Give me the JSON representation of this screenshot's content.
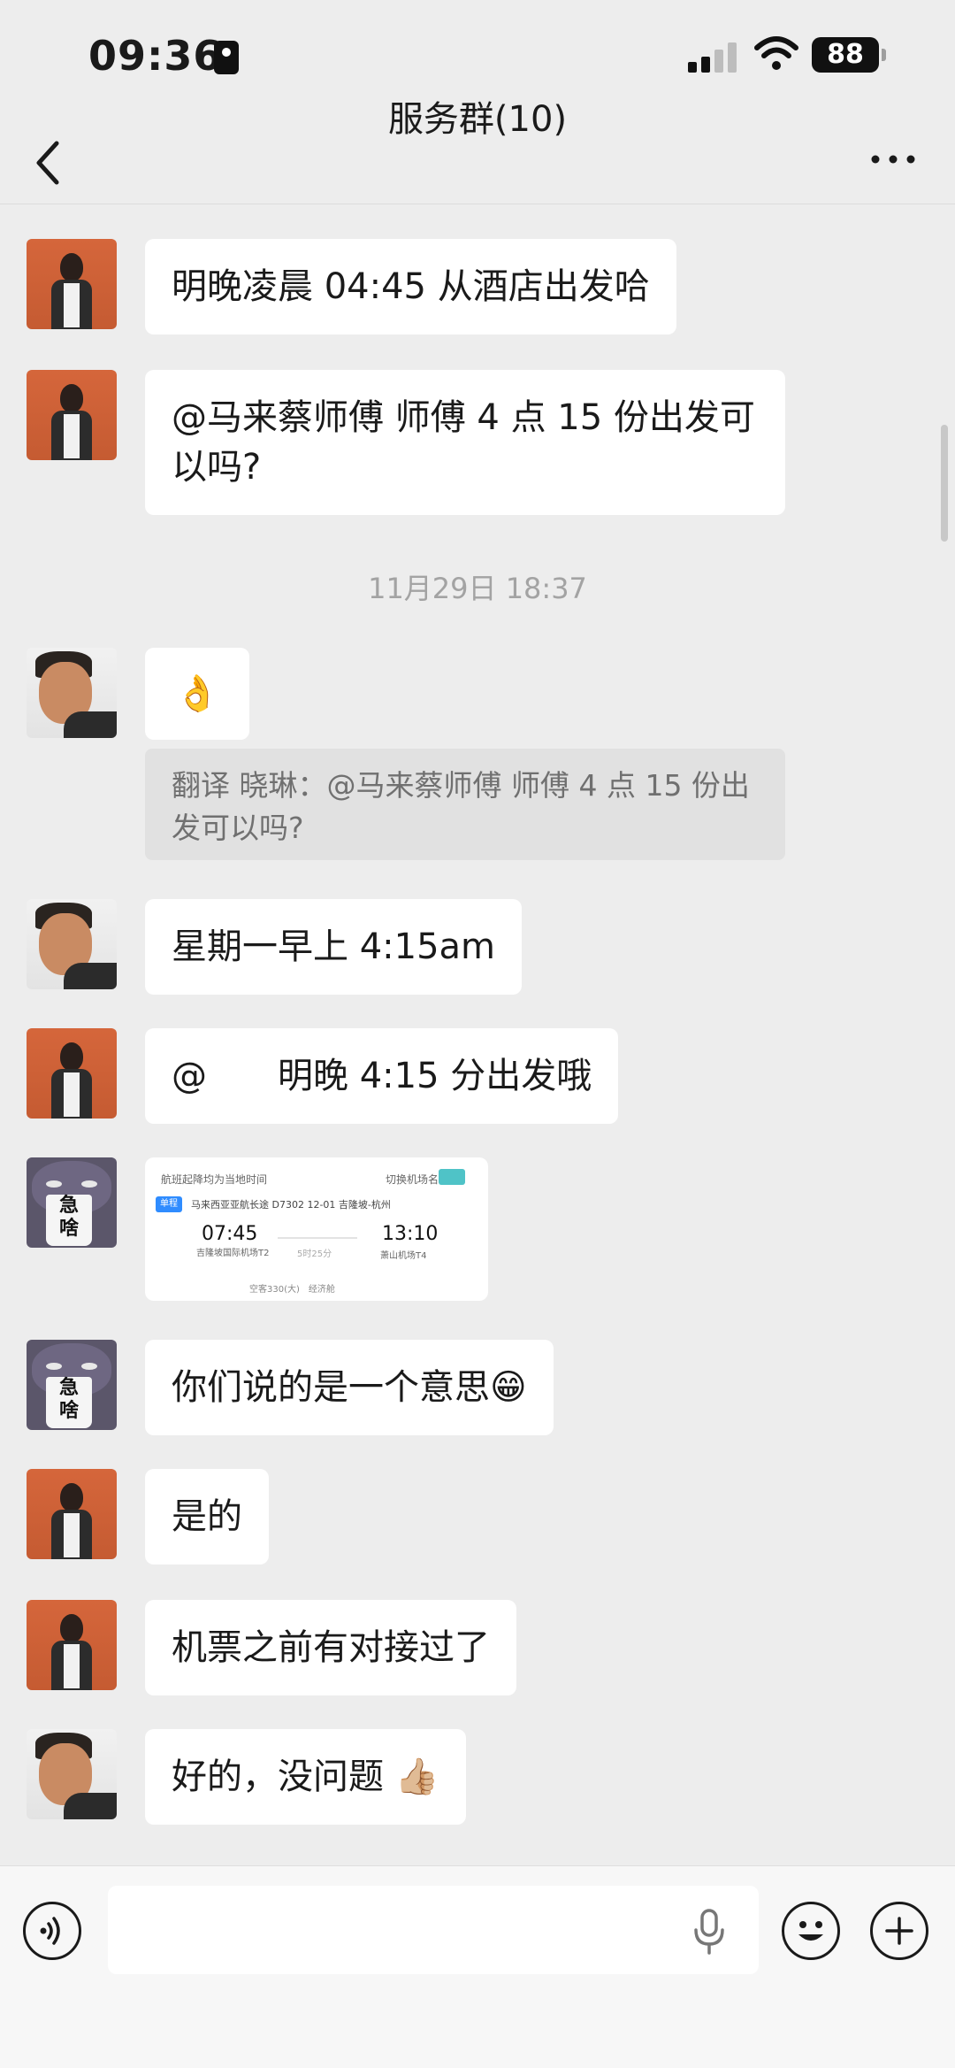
{
  "status_bar": {
    "time": "09:36",
    "battery": "88"
  },
  "header": {
    "title": "服务群(10)"
  },
  "messages": [
    {
      "text": "明晚凌晨 04:45 从酒店出发哈"
    },
    {
      "text": "@马来蔡师傅 师傅 4 点 15 份出发可以吗?"
    },
    {
      "text": "👌"
    },
    {
      "text": "星期一早上 4:15am"
    },
    {
      "text": "@　　明晚 4:15 分出发哦"
    },
    {
      "text": "你们说的是一个意思😁"
    },
    {
      "text": "是的"
    },
    {
      "text": "机票之前有对接过了"
    },
    {
      "text": "好的，没问题 👍🏼"
    }
  ],
  "timestamp": "11月29日 18:37",
  "quote": {
    "text": "翻译 晓琳：@马来蔡师傅 师傅 4 点 15 份出发可以吗?"
  },
  "flight_card": {
    "header": "航班起降均为当地时间",
    "switch_label": "切换机场名",
    "tag": "单程",
    "airline": "马来西亚亚航长途 D7302  12-01 吉隆坡-杭州",
    "dep_time": "07:45",
    "arr_time": "13:10",
    "duration": "5时25分",
    "dep_airport": "吉隆坡国际机场T2",
    "arr_airport": "萧山机场T4",
    "footer": "空客330(大)　经济舱"
  },
  "colors": {
    "background": "#ededed",
    "bubble": "#ffffff",
    "quote_bg": "#e1e1e1"
  },
  "icons": {
    "voice": "voice-icon",
    "emoji": "emoji-icon",
    "add": "plus-circle-icon",
    "mic": "microphone-icon",
    "back": "chevron-left-icon",
    "more": "more-dots-icon"
  }
}
